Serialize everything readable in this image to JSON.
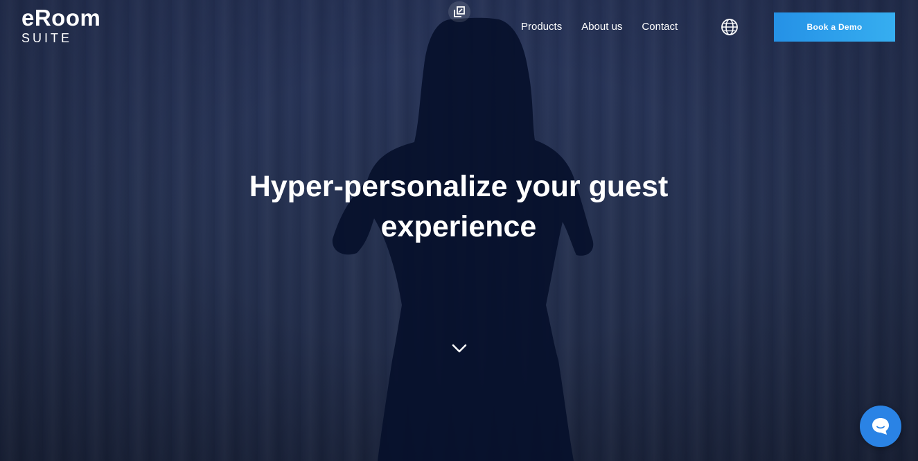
{
  "brand": {
    "name": "eRoom",
    "sub": "SUITE"
  },
  "nav": {
    "items": [
      {
        "label": "Products"
      },
      {
        "label": "About us"
      },
      {
        "label": "Contact"
      }
    ]
  },
  "header": {
    "language_icon": "globe-icon",
    "media_icon": "gallery-icon",
    "demo_button": "Book a Demo"
  },
  "hero": {
    "headline_line1": "Hyper-personalize your guest",
    "headline_line2": "experience",
    "scroll_icon": "chevron-down-icon"
  },
  "chat": {
    "icon": "chat-bubble-icon"
  },
  "colors": {
    "hero_overlay": "#24304f",
    "button_start": "#2591e6",
    "button_end": "#36aef0",
    "chat_button": "#2a83e5",
    "text": "#ffffff"
  }
}
